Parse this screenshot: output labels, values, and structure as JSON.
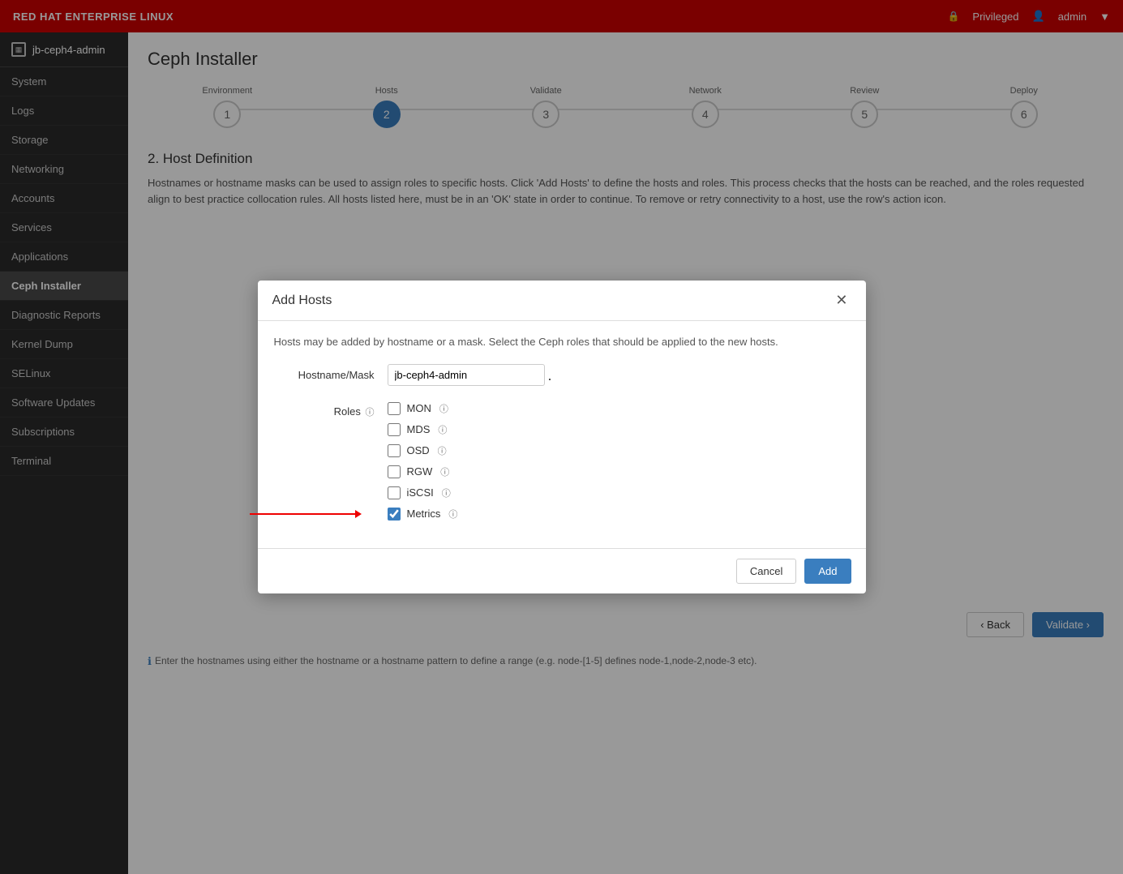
{
  "topnav": {
    "brand": "RED HAT ENTERPRISE LINUX",
    "privileged_label": "Privileged",
    "admin_label": "admin"
  },
  "sidebar": {
    "instance": "jb-ceph4-admin",
    "items": [
      {
        "id": "system",
        "label": "System"
      },
      {
        "id": "logs",
        "label": "Logs"
      },
      {
        "id": "storage",
        "label": "Storage"
      },
      {
        "id": "networking",
        "label": "Networking"
      },
      {
        "id": "accounts",
        "label": "Accounts"
      },
      {
        "id": "services",
        "label": "Services"
      },
      {
        "id": "applications",
        "label": "Applications"
      },
      {
        "id": "ceph-installer",
        "label": "Ceph Installer",
        "active": true
      },
      {
        "id": "diagnostic-reports",
        "label": "Diagnostic Reports"
      },
      {
        "id": "kernel-dump",
        "label": "Kernel Dump"
      },
      {
        "id": "selinux",
        "label": "SELinux"
      },
      {
        "id": "software-updates",
        "label": "Software Updates"
      },
      {
        "id": "subscriptions",
        "label": "Subscriptions"
      },
      {
        "id": "terminal",
        "label": "Terminal"
      }
    ]
  },
  "page": {
    "title": "Ceph Installer",
    "section_heading": "2. Host Definition",
    "section_desc": "Hostnames or hostname masks can be used to assign roles to specific hosts. Click 'Add Hosts' to define the hosts and roles. This process checks that the hosts can be reached, and the roles requested align to best practice collocation rules. All hosts listed here, must be in an 'OK' state in order to continue. To remove or retry connectivity to a host, use the row's action icon.",
    "footer_note": "Enter the hostnames using either the hostname or a hostname pattern to define a range (e.g. node-[1-5] defines node-1,node-2,node-3 etc)."
  },
  "wizard": {
    "steps": [
      {
        "label": "Environment",
        "number": "1",
        "active": false
      },
      {
        "label": "Hosts",
        "number": "2",
        "active": true
      },
      {
        "label": "Validate",
        "number": "3",
        "active": false
      },
      {
        "label": "Network",
        "number": "4",
        "active": false
      },
      {
        "label": "Review",
        "number": "5",
        "active": false
      },
      {
        "label": "Deploy",
        "number": "6",
        "active": false
      }
    ]
  },
  "modal": {
    "title": "Add Hosts",
    "description": "Hosts may be added by hostname or a mask. Select the Ceph roles that should be applied to the new hosts.",
    "hostname_label": "Hostname/Mask",
    "hostname_value": "jb-ceph4-admin",
    "hostname_placeholder": "jb-ceph4-admin",
    "roles_label": "Roles",
    "roles": [
      {
        "id": "mon",
        "label": "MON",
        "checked": false
      },
      {
        "id": "mds",
        "label": "MDS",
        "checked": false
      },
      {
        "id": "osd",
        "label": "OSD",
        "checked": false
      },
      {
        "id": "rgw",
        "label": "RGW",
        "checked": false
      },
      {
        "id": "iscsi",
        "label": "iSCSI",
        "checked": false
      },
      {
        "id": "metrics",
        "label": "Metrics",
        "checked": true
      }
    ],
    "cancel_label": "Cancel",
    "add_label": "Add"
  },
  "bottom_nav": {
    "back_label": "‹ Back",
    "validate_label": "Validate ›"
  }
}
